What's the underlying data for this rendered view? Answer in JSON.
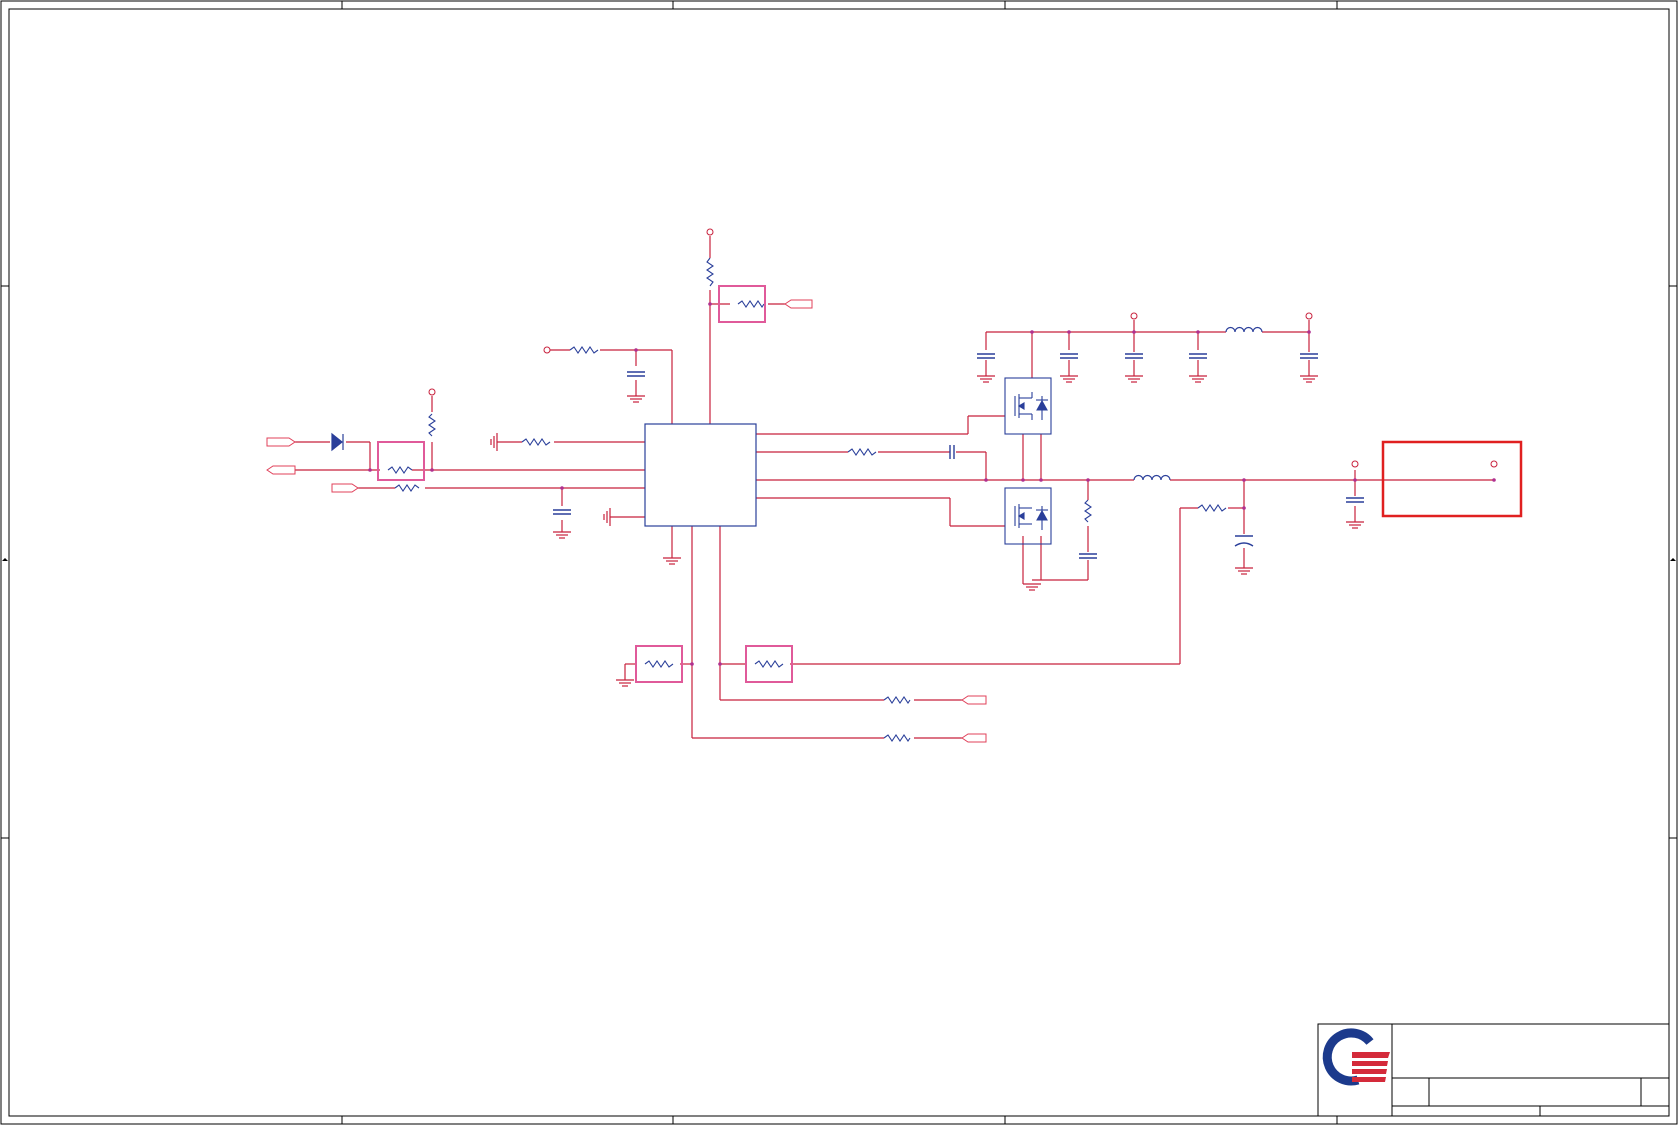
{
  "sheet": {
    "title_block": {
      "logo": "quanta-q-logo",
      "title": "",
      "doc_number": "",
      "size": "",
      "rev": "",
      "date": "",
      "sheet_of": ""
    },
    "border_zones": {
      "columns": [
        "",
        "",
        "",
        "",
        ""
      ],
      "rows": [
        "",
        "",
        ""
      ]
    },
    "colors": {
      "wire": "#c8203c",
      "component": "#2a3f9a",
      "net_port": "#e0405a",
      "highlight_box": "#e05a9a",
      "selection_box": "#e02020",
      "junction": "#b03090",
      "logo_blue": "#1c3a8c",
      "logo_red": "#d42a3a"
    }
  }
}
